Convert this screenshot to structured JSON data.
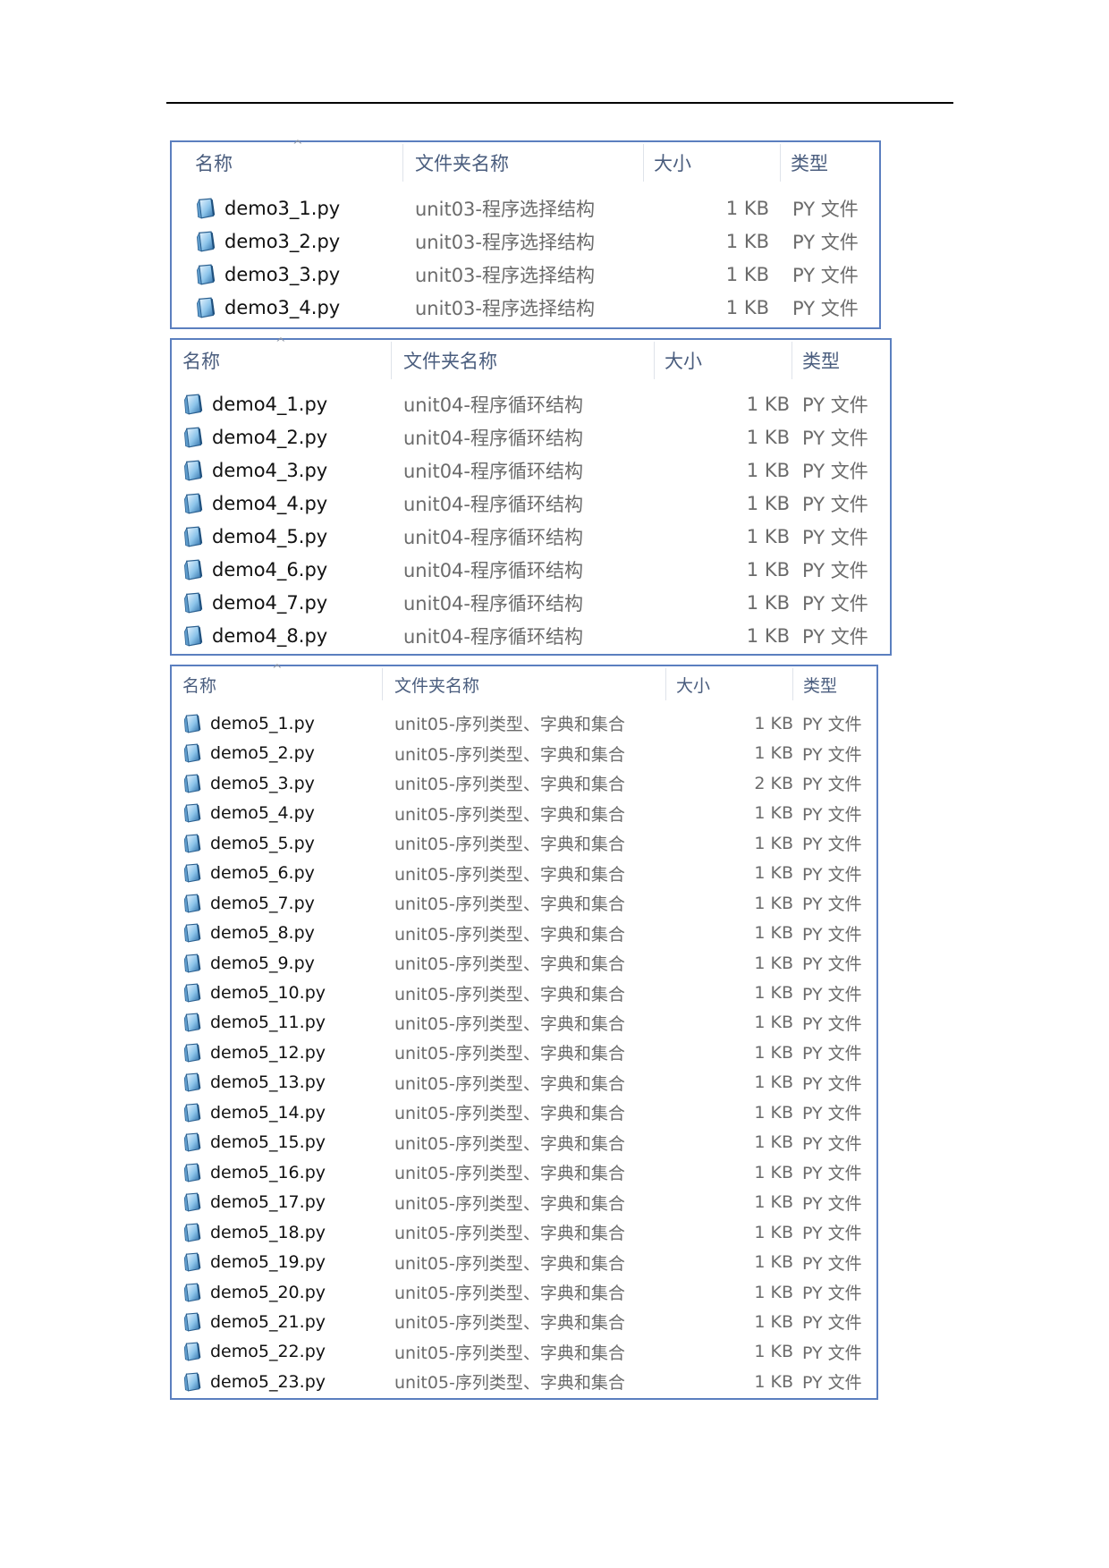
{
  "headers": {
    "name": "名称",
    "folder": "文件夹名称",
    "size": "大小",
    "type": "类型"
  },
  "panels": [
    {
      "rows": [
        {
          "name": "demo3_1.py",
          "folder": "unit03-程序选择结构",
          "size": "1 KB",
          "type": "PY 文件"
        },
        {
          "name": "demo3_2.py",
          "folder": "unit03-程序选择结构",
          "size": "1 KB",
          "type": "PY 文件"
        },
        {
          "name": "demo3_3.py",
          "folder": "unit03-程序选择结构",
          "size": "1 KB",
          "type": "PY 文件"
        },
        {
          "name": "demo3_4.py",
          "folder": "unit03-程序选择结构",
          "size": "1 KB",
          "type": "PY 文件"
        }
      ]
    },
    {
      "rows": [
        {
          "name": "demo4_1.py",
          "folder": "unit04-程序循环结构",
          "size": "1 KB",
          "type": "PY 文件"
        },
        {
          "name": "demo4_2.py",
          "folder": "unit04-程序循环结构",
          "size": "1 KB",
          "type": "PY 文件"
        },
        {
          "name": "demo4_3.py",
          "folder": "unit04-程序循环结构",
          "size": "1 KB",
          "type": "PY 文件"
        },
        {
          "name": "demo4_4.py",
          "folder": "unit04-程序循环结构",
          "size": "1 KB",
          "type": "PY 文件"
        },
        {
          "name": "demo4_5.py",
          "folder": "unit04-程序循环结构",
          "size": "1 KB",
          "type": "PY 文件"
        },
        {
          "name": "demo4_6.py",
          "folder": "unit04-程序循环结构",
          "size": "1 KB",
          "type": "PY 文件"
        },
        {
          "name": "demo4_7.py",
          "folder": "unit04-程序循环结构",
          "size": "1 KB",
          "type": "PY 文件"
        },
        {
          "name": "demo4_8.py",
          "folder": "unit04-程序循环结构",
          "size": "1 KB",
          "type": "PY 文件"
        }
      ]
    },
    {
      "rows": [
        {
          "name": "demo5_1.py",
          "folder": "unit05-序列类型、字典和集合",
          "size": "1 KB",
          "type": "PY 文件"
        },
        {
          "name": "demo5_2.py",
          "folder": "unit05-序列类型、字典和集合",
          "size": "1 KB",
          "type": "PY 文件"
        },
        {
          "name": "demo5_3.py",
          "folder": "unit05-序列类型、字典和集合",
          "size": "2 KB",
          "type": "PY 文件"
        },
        {
          "name": "demo5_4.py",
          "folder": "unit05-序列类型、字典和集合",
          "size": "1 KB",
          "type": "PY 文件"
        },
        {
          "name": "demo5_5.py",
          "folder": "unit05-序列类型、字典和集合",
          "size": "1 KB",
          "type": "PY 文件"
        },
        {
          "name": "demo5_6.py",
          "folder": "unit05-序列类型、字典和集合",
          "size": "1 KB",
          "type": "PY 文件"
        },
        {
          "name": "demo5_7.py",
          "folder": "unit05-序列类型、字典和集合",
          "size": "1 KB",
          "type": "PY 文件"
        },
        {
          "name": "demo5_8.py",
          "folder": "unit05-序列类型、字典和集合",
          "size": "1 KB",
          "type": "PY 文件"
        },
        {
          "name": "demo5_9.py",
          "folder": "unit05-序列类型、字典和集合",
          "size": "1 KB",
          "type": "PY 文件"
        },
        {
          "name": "demo5_10.py",
          "folder": "unit05-序列类型、字典和集合",
          "size": "1 KB",
          "type": "PY 文件"
        },
        {
          "name": "demo5_11.py",
          "folder": "unit05-序列类型、字典和集合",
          "size": "1 KB",
          "type": "PY 文件"
        },
        {
          "name": "demo5_12.py",
          "folder": "unit05-序列类型、字典和集合",
          "size": "1 KB",
          "type": "PY 文件"
        },
        {
          "name": "demo5_13.py",
          "folder": "unit05-序列类型、字典和集合",
          "size": "1 KB",
          "type": "PY 文件"
        },
        {
          "name": "demo5_14.py",
          "folder": "unit05-序列类型、字典和集合",
          "size": "1 KB",
          "type": "PY 文件"
        },
        {
          "name": "demo5_15.py",
          "folder": "unit05-序列类型、字典和集合",
          "size": "1 KB",
          "type": "PY 文件"
        },
        {
          "name": "demo5_16.py",
          "folder": "unit05-序列类型、字典和集合",
          "size": "1 KB",
          "type": "PY 文件"
        },
        {
          "name": "demo5_17.py",
          "folder": "unit05-序列类型、字典和集合",
          "size": "1 KB",
          "type": "PY 文件"
        },
        {
          "name": "demo5_18.py",
          "folder": "unit05-序列类型、字典和集合",
          "size": "1 KB",
          "type": "PY 文件"
        },
        {
          "name": "demo5_19.py",
          "folder": "unit05-序列类型、字典和集合",
          "size": "1 KB",
          "type": "PY 文件"
        },
        {
          "name": "demo5_20.py",
          "folder": "unit05-序列类型、字典和集合",
          "size": "1 KB",
          "type": "PY 文件"
        },
        {
          "name": "demo5_21.py",
          "folder": "unit05-序列类型、字典和集合",
          "size": "1 KB",
          "type": "PY 文件"
        },
        {
          "name": "demo5_22.py",
          "folder": "unit05-序列类型、字典和集合",
          "size": "1 KB",
          "type": "PY 文件"
        },
        {
          "name": "demo5_23.py",
          "folder": "unit05-序列类型、字典和集合",
          "size": "1 KB",
          "type": "PY 文件"
        }
      ]
    }
  ]
}
